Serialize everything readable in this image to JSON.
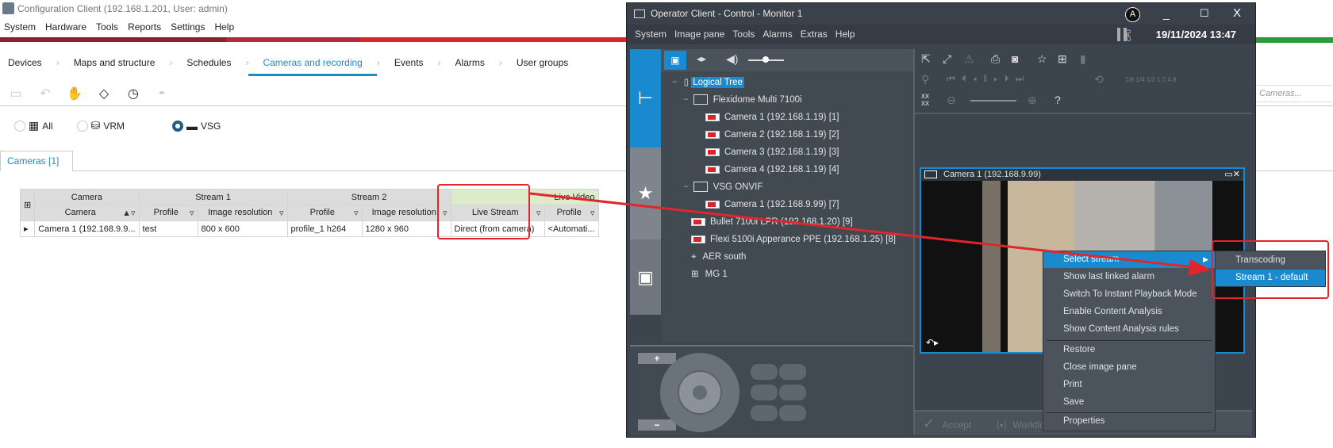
{
  "config_client": {
    "title": "Configuration Client (192.168.1.201, User: admin)",
    "menu": [
      "System",
      "Hardware",
      "Tools",
      "Reports",
      "Settings",
      "Help"
    ],
    "tabs": [
      "Devices",
      "Maps and structure",
      "Schedules",
      "Cameras and recording",
      "Events",
      "Alarms",
      "User groups"
    ],
    "active_tab": "Cameras and recording",
    "filters": [
      {
        "label": "All",
        "selected": false
      },
      {
        "label": "VRM",
        "selected": false
      },
      {
        "label": "VSG",
        "selected": true
      }
    ],
    "subtab": "Cameras [1]",
    "search_placeholder": "Cameras...",
    "table": {
      "groups": [
        "Camera",
        "Stream 1",
        "Stream 2",
        "Live Video"
      ],
      "columns": [
        "Camera",
        "Profile",
        "Image resolution",
        "Profile",
        "Image resolution",
        "Live Stream",
        "Profile"
      ],
      "rows": [
        [
          "Camera 1 (192.168.9.9...",
          "test",
          "800 x 600",
          "profile_1 h264",
          "1280 x 960",
          "Direct (from camera)",
          "<Automati..."
        ]
      ]
    }
  },
  "operator_client": {
    "title": "Operator Client - Control - Monitor 1",
    "user_badge": "A",
    "menu": [
      "System",
      "Image pane",
      "Tools",
      "Alarms",
      "Extras",
      "Help"
    ],
    "cpu_label": "CPU",
    "datetime": "19/11/2024 13:47",
    "speed_labels": "1/8 1/4 1/2  1   2   4   8",
    "help_icon": "?",
    "tree": {
      "root": "Logical Tree",
      "items": [
        "Flexidome Multi 7100i",
        "Camera 1 (192.168.1.19) [1]",
        "Camera 2 (192.168.1.19) [2]",
        "Camera 3 (192.168.1.19) [3]",
        "Camera 4 (192.168.1.19) [4]",
        "VSG ONVIF",
        "Camera 1 (192.168.9.99) [7]",
        "Bullet 7100i LPR (192.168.1.20) [9]",
        "Flexi 5100i Apperance PPE (192.168.1.25) [8]",
        "AER south",
        "MG 1"
      ]
    },
    "image_pane_title": "Camera 1 (192.168.9.99)",
    "bottom": {
      "accept": "Accept",
      "workflow": "Workflow"
    },
    "context_menu": [
      "Select stream",
      "Show last linked alarm",
      "Switch To Instant Playback Mode",
      "Enable Content Analysis",
      "Show Content Analysis rules",
      "Restore",
      "Close image pane",
      "Print",
      "Save",
      "Properties"
    ],
    "submenu": [
      "Transcoding",
      "Stream 1 - default"
    ],
    "submenu_selected": "Stream 1 - default"
  },
  "colors": {
    "accent": "#1a8ad0",
    "annotation": "#e0262a",
    "dark_bg": "#3c444e"
  }
}
